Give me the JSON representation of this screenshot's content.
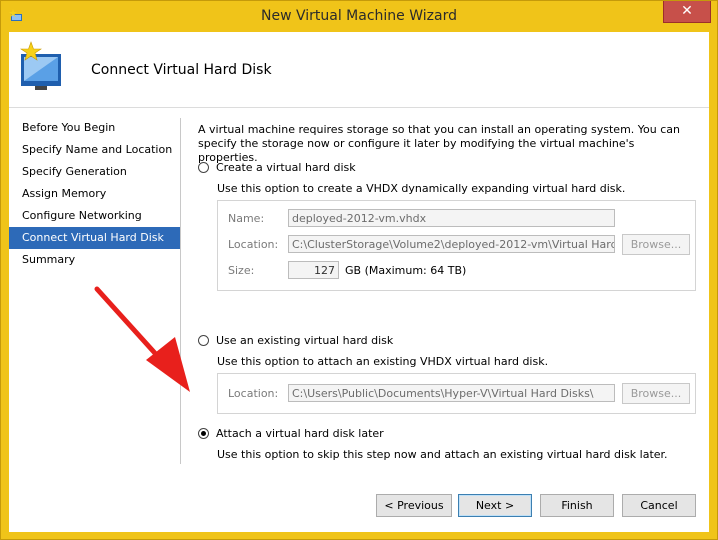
{
  "window": {
    "title": "New Virtual Machine Wizard",
    "close_glyph": "✕"
  },
  "header": {
    "title": "Connect Virtual Hard Disk"
  },
  "nav": {
    "items": [
      {
        "label": "Before You Begin",
        "active": false
      },
      {
        "label": "Specify Name and Location",
        "active": false
      },
      {
        "label": "Specify Generation",
        "active": false
      },
      {
        "label": "Assign Memory",
        "active": false
      },
      {
        "label": "Configure Networking",
        "active": false
      },
      {
        "label": "Connect Virtual Hard Disk",
        "active": true
      },
      {
        "label": "Summary",
        "active": false
      }
    ]
  },
  "content": {
    "description": "A virtual machine requires storage so that you can install an operating system. You can specify the storage now or configure it later by modifying the virtual machine's properties.",
    "option_create": {
      "label": "Create a virtual hard disk",
      "help": "Use this option to create a VHDX dynamically expanding virtual hard disk.",
      "selected": false,
      "name_label": "Name:",
      "name_value": "deployed-2012-vm.vhdx",
      "location_label": "Location:",
      "location_value": "C:\\ClusterStorage\\Volume2\\deployed-2012-vm\\Virtual Hard",
      "size_label": "Size:",
      "size_value": "127",
      "size_unit": "GB (Maximum: 64 TB)",
      "browse_label": "Browse..."
    },
    "option_existing": {
      "label": "Use an existing virtual hard disk",
      "help": "Use this option to attach an existing VHDX virtual hard disk.",
      "selected": false,
      "location_label": "Location:",
      "location_value": "C:\\Users\\Public\\Documents\\Hyper-V\\Virtual Hard Disks\\",
      "browse_label": "Browse..."
    },
    "option_later": {
      "label": "Attach a virtual hard disk later",
      "help": "Use this option to skip this step now and attach an existing virtual hard disk later.",
      "selected": true
    }
  },
  "buttons": {
    "previous": "< Previous",
    "next": "Next >",
    "finish": "Finish",
    "cancel": "Cancel"
  },
  "colors": {
    "frame": "#f0c419",
    "close": "#c7504a",
    "nav_active": "#2d6ab8",
    "annotation_arrow": "#e8201c"
  }
}
